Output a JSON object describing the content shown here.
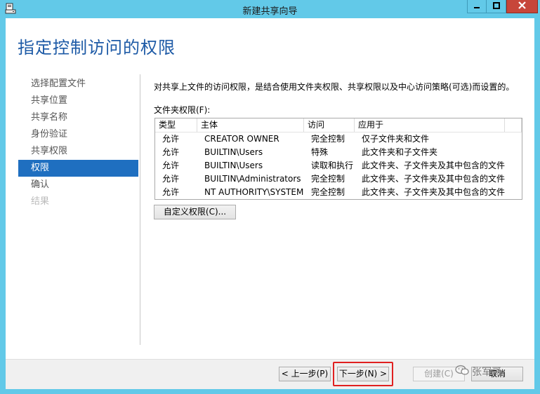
{
  "window": {
    "title": "新建共享向导"
  },
  "page": {
    "heading": "指定控制访问的权限",
    "description": "对共享上文件的访问权限，是结合使用文件夹权限、共享权限以及中心访问策略(可选)而设置的。",
    "folder_permissions_label": "文件夹权限(F):"
  },
  "nav": {
    "items": [
      {
        "label": "选择配置文件",
        "state": "normal"
      },
      {
        "label": "共享位置",
        "state": "normal"
      },
      {
        "label": "共享名称",
        "state": "normal"
      },
      {
        "label": "身份验证",
        "state": "normal"
      },
      {
        "label": "共享权限",
        "state": "normal"
      },
      {
        "label": "权限",
        "state": "active"
      },
      {
        "label": "确认",
        "state": "normal"
      },
      {
        "label": "结果",
        "state": "disabled"
      }
    ]
  },
  "permissions_table": {
    "columns": [
      "类型",
      "主体",
      "访问",
      "应用于"
    ],
    "rows": [
      [
        "允许",
        "CREATOR OWNER",
        "完全控制",
        "仅子文件夹和文件"
      ],
      [
        "允许",
        "BUILTIN\\Users",
        "特殊",
        "此文件夹和子文件夹"
      ],
      [
        "允许",
        "BUILTIN\\Users",
        "读取和执行",
        "此文件夹、子文件夹及其中包含的文件"
      ],
      [
        "允许",
        "BUILTIN\\Administrators",
        "完全控制",
        "此文件夹、子文件夹及其中包含的文件"
      ],
      [
        "允许",
        "NT AUTHORITY\\SYSTEM",
        "完全控制",
        "此文件夹、子文件夹及其中包含的文件"
      ]
    ]
  },
  "buttons": {
    "custom_permissions": "自定义权限(C)...",
    "previous": "< 上一步(P)",
    "next": "下一步(N) >",
    "create": "创建(C)",
    "cancel": "取消"
  },
  "watermark": {
    "text": "张军哥"
  },
  "colors": {
    "title_bar": "#62c9e8",
    "heading": "#1d5aa6",
    "nav_active": "#1f6fc0",
    "close_button": "#c7463a",
    "highlight": "#e02020"
  }
}
